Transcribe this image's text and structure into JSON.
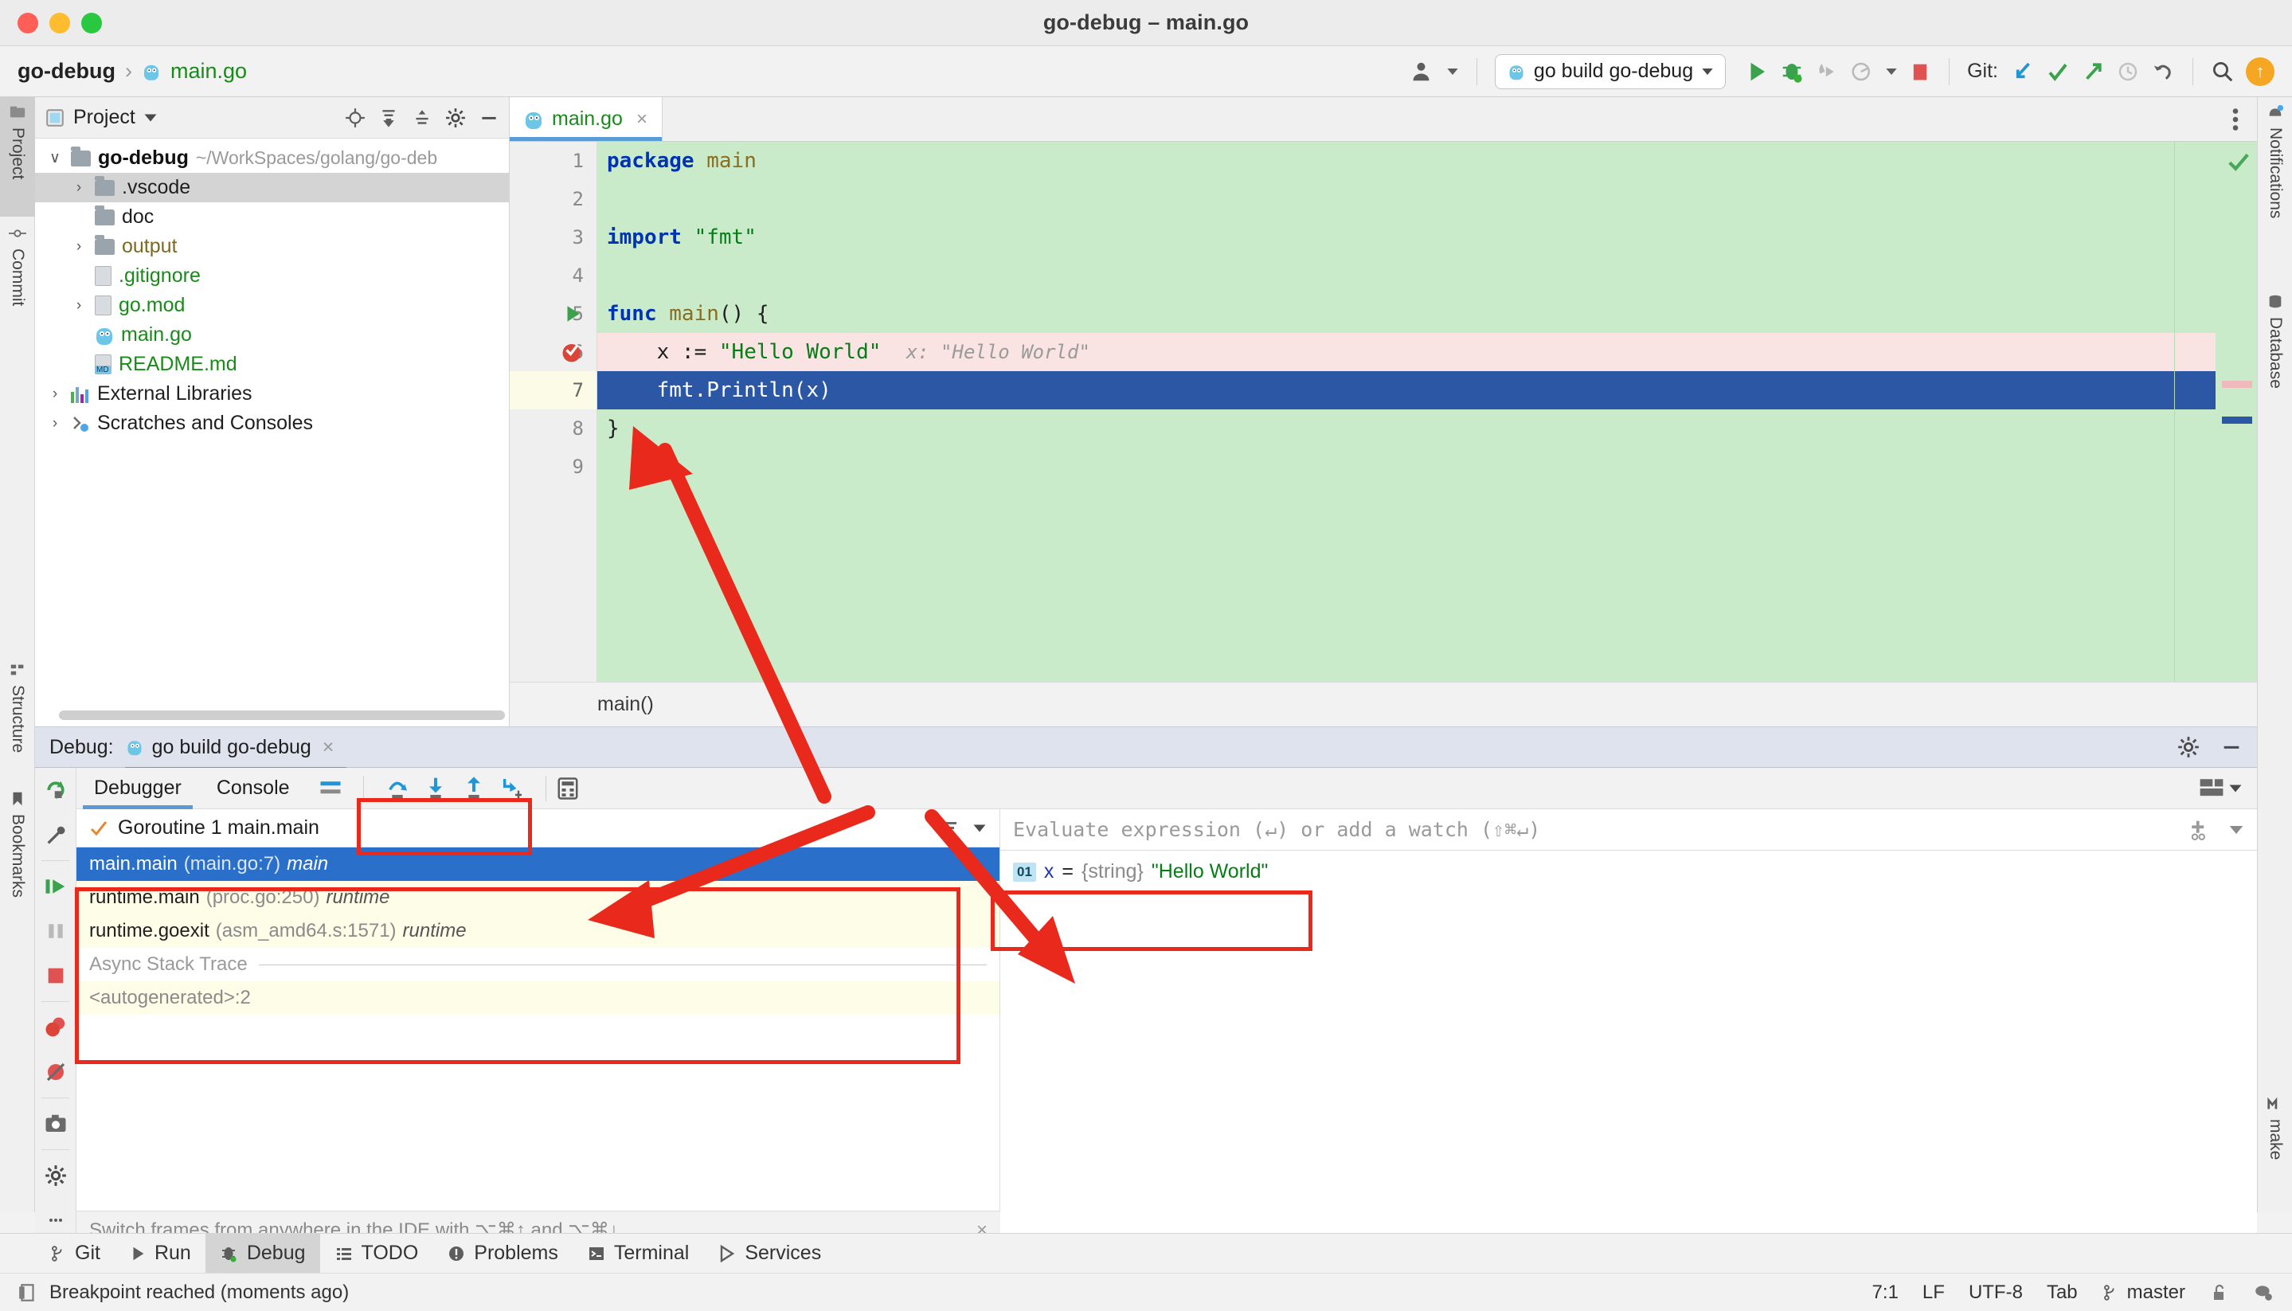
{
  "window": {
    "title": "go-debug – main.go"
  },
  "toolbar": {
    "breadcrumb": {
      "project": "go-debug",
      "separator": "›",
      "file": "main.go"
    },
    "run_config": "go build go-debug",
    "git_label": "Git:",
    "icons": [
      "user-avatar-icon",
      "run-icon",
      "debug-icon",
      "run-with-coverage-icon",
      "profile-icon",
      "stop-icon",
      "git-update-icon",
      "git-commit-icon",
      "git-push-icon",
      "history-icon",
      "rollback-icon",
      "search-everywhere-icon",
      "updates-available-icon"
    ]
  },
  "left_rail": {
    "top": [
      {
        "label": "Project",
        "icon": "project-icon",
        "active": true
      },
      {
        "label": "Commit",
        "icon": "commit-icon",
        "active": false
      }
    ],
    "bottom": [
      {
        "label": "Structure",
        "icon": "structure-icon"
      },
      {
        "label": "Bookmarks",
        "icon": "bookmarks-icon"
      }
    ]
  },
  "right_rail": {
    "top": [
      {
        "label": "Notifications",
        "icon": "notifications-icon"
      },
      {
        "label": "Database",
        "icon": "database-icon"
      }
    ],
    "bottom": [
      {
        "label": "make",
        "icon": "make-icon"
      }
    ]
  },
  "project_panel": {
    "title": "Project",
    "head_icons": [
      "locate-icon",
      "expand-all-icon",
      "collapse-all-icon",
      "settings-icon",
      "hide-icon"
    ],
    "tree": [
      {
        "label": "go-debug",
        "path": "~/WorkSpaces/golang/go-deb",
        "type": "root",
        "arrow": "∨",
        "depth": 0,
        "selected": false
      },
      {
        "label": ".vscode",
        "path": "",
        "type": "folder",
        "arrow": "›",
        "depth": 1,
        "selected": true
      },
      {
        "label": "doc",
        "path": "",
        "type": "folder",
        "arrow": "",
        "depth": 1,
        "selected": false
      },
      {
        "label": "output",
        "path": "",
        "type": "folder-olive",
        "arrow": "›",
        "depth": 1,
        "selected": false
      },
      {
        "label": ".gitignore",
        "path": "",
        "type": "file-ignore",
        "arrow": "",
        "depth": 1,
        "selected": false
      },
      {
        "label": "go.mod",
        "path": "",
        "type": "file-mod",
        "arrow": "›",
        "depth": 1,
        "selected": false
      },
      {
        "label": "main.go",
        "path": "",
        "type": "file-go",
        "arrow": "",
        "depth": 1,
        "selected": false
      },
      {
        "label": "README.md",
        "path": "",
        "type": "file-md",
        "arrow": "",
        "depth": 1,
        "selected": false
      },
      {
        "label": "External Libraries",
        "path": "",
        "type": "libs",
        "arrow": "›",
        "depth": 0,
        "selected": false
      },
      {
        "label": "Scratches and Consoles",
        "path": "",
        "type": "scratches",
        "arrow": "›",
        "depth": 0,
        "selected": false
      }
    ]
  },
  "editor": {
    "tab": {
      "label": "main.go",
      "close": "×",
      "icon": "go-file-icon"
    },
    "more_icon": "more-vertical-icon",
    "breadcrumb": "main()",
    "inspection_icon": "inspections-ok-icon",
    "lines": [
      {
        "n": "1",
        "state": "normal",
        "gutter": "",
        "html": "<span class='kw'>package</span> <span class='pkg'>main</span>"
      },
      {
        "n": "2",
        "state": "normal",
        "gutter": "",
        "html": ""
      },
      {
        "n": "3",
        "state": "normal",
        "gutter": "",
        "html": "<span class='kw'>import</span> <span class='str'>\"fmt\"</span>"
      },
      {
        "n": "4",
        "state": "normal",
        "gutter": "",
        "html": ""
      },
      {
        "n": "5",
        "state": "normal",
        "gutter": "run-gutter-icon",
        "html": "<span class='kw'>func</span> <span class='pkg'>main</span>() {"
      },
      {
        "n": "6",
        "state": "bp",
        "gutter": "breakpoint-icon",
        "html": "    x := <span class='str'>\"Hello World\"</span>  <span class='inlay'>x: \"Hello World\"</span>"
      },
      {
        "n": "7",
        "state": "exec",
        "gutter": "",
        "html": "    fmt.Println(x)"
      },
      {
        "n": "8",
        "state": "normal",
        "gutter": "",
        "html": "}"
      },
      {
        "n": "9",
        "state": "normal",
        "gutter": "",
        "html": ""
      }
    ]
  },
  "debug": {
    "header": {
      "label": "Debug:",
      "run_name": "go build go-debug",
      "close": "×",
      "icons": [
        "settings-icon",
        "hide-icon"
      ]
    },
    "tabs": [
      {
        "label": "Debugger",
        "active": true
      },
      {
        "label": "Console",
        "active": false
      }
    ],
    "layout_icon": "layout-settings-icon",
    "step_buttons": [
      "step-over-icon",
      "step-into-icon",
      "step-out-icon",
      "force-step-into-icon"
    ],
    "evaluate_icon": "evaluate-expression-icon",
    "restore_layout_icon": "restore-layout-icon",
    "rail_icons": [
      "rerun-icon",
      "debug-settings-icon",
      "resume-icon",
      "pause-icon",
      "stop-icon",
      "view-breakpoints-icon",
      "mute-breakpoints-icon",
      "screenshot-icon",
      "settings-gear-icon",
      "more-icon"
    ],
    "goroutine": {
      "label": "Goroutine 1 main.main",
      "check_icon": "check-icon",
      "icons": [
        "filter-icon",
        "chevron-down-icon"
      ]
    },
    "frames": [
      {
        "name": "main.main",
        "loc": "(main.go:7)",
        "mod": "main",
        "selected": true
      },
      {
        "name": "runtime.main",
        "loc": "(proc.go:250)",
        "mod": "runtime",
        "selected": false
      },
      {
        "name": "runtime.goexit",
        "loc": "(asm_amd64.s:1571)",
        "mod": "runtime",
        "selected": false
      }
    ],
    "async_label": "Async Stack Trace",
    "autogenerated": "<autogenerated>:2",
    "hint": "Switch frames from anywhere in the IDE with ⌥⌘↑ and ⌥⌘↓",
    "hint_close": "×",
    "evaluate_placeholder": "Evaluate expression (↵) or add a watch (⇧⌘↵)",
    "watch_icons": [
      "add-watch-icon",
      "chevron-down-icon"
    ],
    "variables": [
      {
        "badge": "01",
        "name": "x",
        "equals": "=",
        "type": "{string}",
        "value": "\"Hello World\""
      }
    ]
  },
  "tool_strip": [
    {
      "label": "Git",
      "icon": "git-icon",
      "active": false
    },
    {
      "label": "Run",
      "icon": "run-icon",
      "active": false
    },
    {
      "label": "Debug",
      "icon": "debug-icon",
      "active": true
    },
    {
      "label": "TODO",
      "icon": "todo-icon",
      "active": false
    },
    {
      "label": "Problems",
      "icon": "problems-icon",
      "active": false
    },
    {
      "label": "Terminal",
      "icon": "terminal-icon",
      "active": false
    },
    {
      "label": "Services",
      "icon": "services-icon",
      "active": false
    }
  ],
  "status_bar": {
    "message": "Breakpoint reached (moments ago)",
    "message_icon": "memory-icon",
    "caret": "7:1",
    "line_sep": "LF",
    "encoding": "UTF-8",
    "indent": "Tab",
    "branch": "master",
    "branch_icon": "branch-icon",
    "lock_icon": "unlocked-icon",
    "inspector_icon": "inspector-icon"
  },
  "annotations": {
    "color": "#e8291c",
    "highlight_boxes": [
      "step-buttons-box",
      "frames-list-box",
      "watch-variable-box"
    ],
    "arrows": [
      "arrow-to-editor",
      "arrow-to-step-buttons",
      "arrow-to-watch-panel"
    ]
  }
}
